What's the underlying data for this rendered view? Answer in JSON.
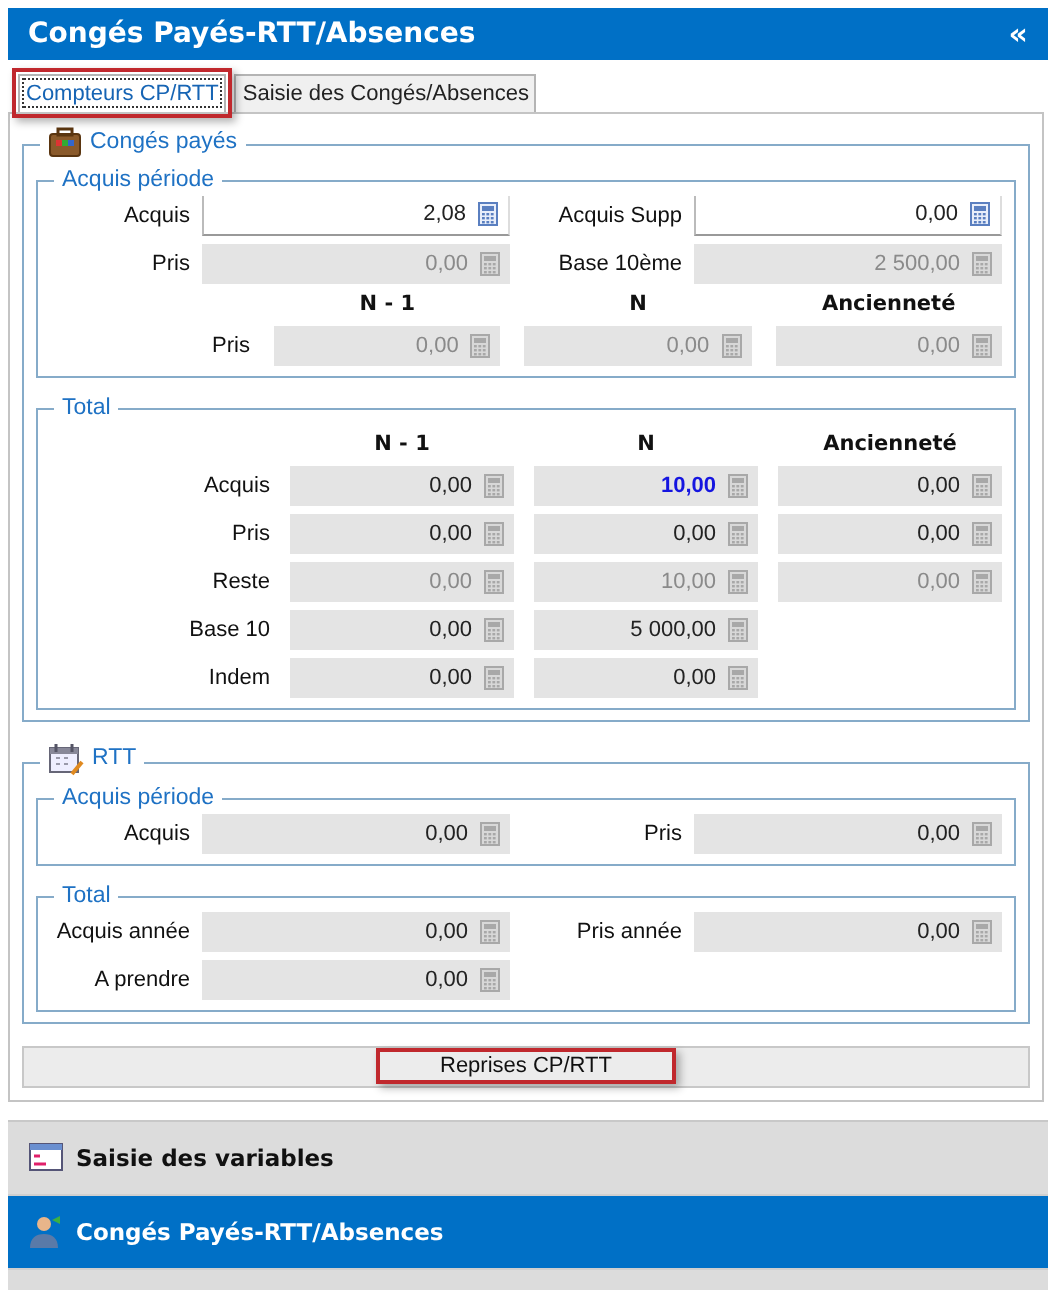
{
  "header": {
    "title": "Congés Payés-RTT/Absences",
    "collapse_icon": "«"
  },
  "tabs": [
    {
      "label": "Compteurs CP/RTT",
      "selected": true,
      "highlighted": true
    },
    {
      "label": "Saisie des Congés/Absences",
      "selected": false,
      "highlighted": false
    }
  ],
  "conges_payes": {
    "title": "Congés payés",
    "acquis_periode": {
      "title": "Acquis période",
      "fields": [
        {
          "label": "Acquis",
          "value": "2,08",
          "editable": true,
          "disabled": false,
          "highlighted": false
        },
        {
          "label": "Acquis Supp",
          "value": "0,00",
          "editable": true,
          "disabled": false,
          "highlighted": false
        },
        {
          "label": "Pris",
          "value": "0,00",
          "editable": false,
          "disabled": true,
          "highlighted": false
        },
        {
          "label": "Base 10ème",
          "value": "2 500,00",
          "editable": false,
          "disabled": true,
          "highlighted": false
        }
      ],
      "columns": [
        "N - 1",
        "N",
        "Ancienneté"
      ],
      "rows": [
        {
          "label": "Pris",
          "cells": [
            {
              "value": "0,00",
              "editable": false,
              "disabled": true,
              "highlighted": false
            },
            {
              "value": "0,00",
              "editable": false,
              "disabled": true,
              "highlighted": false
            },
            {
              "value": "0,00",
              "editable": false,
              "disabled": true,
              "highlighted": false
            }
          ]
        }
      ]
    },
    "total": {
      "title": "Total",
      "columns": [
        "N - 1",
        "N",
        "Ancienneté"
      ],
      "rows": [
        {
          "label": "Acquis",
          "cells": [
            {
              "value": "0,00",
              "editable": false,
              "disabled": false,
              "highlighted": false
            },
            {
              "value": "10,00",
              "editable": false,
              "disabled": false,
              "highlighted": true
            },
            {
              "value": "0,00",
              "editable": false,
              "disabled": false,
              "highlighted": false
            }
          ]
        },
        {
          "label": "Pris",
          "cells": [
            {
              "value": "0,00",
              "editable": false,
              "disabled": false,
              "highlighted": false
            },
            {
              "value": "0,00",
              "editable": false,
              "disabled": false,
              "highlighted": false
            },
            {
              "value": "0,00",
              "editable": false,
              "disabled": false,
              "highlighted": false
            }
          ]
        },
        {
          "label": "Reste",
          "cells": [
            {
              "value": "0,00",
              "editable": false,
              "disabled": true,
              "highlighted": false
            },
            {
              "value": "10,00",
              "editable": false,
              "disabled": true,
              "highlighted": false
            },
            {
              "value": "0,00",
              "editable": false,
              "disabled": true,
              "highlighted": false
            }
          ]
        },
        {
          "label": "Base 10",
          "cells": [
            {
              "value": "0,00",
              "editable": false,
              "disabled": false,
              "highlighted": false
            },
            {
              "value": "5 000,00",
              "editable": false,
              "disabled": false,
              "highlighted": false
            }
          ]
        },
        {
          "label": "Indem",
          "cells": [
            {
              "value": "0,00",
              "editable": false,
              "disabled": false,
              "highlighted": false
            },
            {
              "value": "0,00",
              "editable": false,
              "disabled": false,
              "highlighted": false
            }
          ]
        }
      ]
    }
  },
  "rtt": {
    "title": "RTT",
    "acquis_periode": {
      "title": "Acquis période",
      "fields": [
        {
          "label": "Acquis",
          "value": "0,00",
          "editable": false,
          "disabled": false,
          "highlighted": false
        },
        {
          "label": "Pris",
          "value": "0,00",
          "editable": false,
          "disabled": false,
          "highlighted": false
        }
      ]
    },
    "total": {
      "title": "Total",
      "fields": [
        {
          "label": "Acquis année",
          "value": "0,00",
          "editable": false,
          "disabled": false,
          "highlighted": false
        },
        {
          "label": "Pris année",
          "value": "0,00",
          "editable": false,
          "disabled": false,
          "highlighted": false
        },
        {
          "label": "A prendre",
          "value": "0,00",
          "editable": false,
          "disabled": false,
          "highlighted": false
        }
      ]
    }
  },
  "reprises_button": {
    "label": "Reprises CP/RTT",
    "highlighted": true
  },
  "nav": [
    {
      "label": "Saisie des variables",
      "selected": false
    },
    {
      "label": "Congés Payés-RTT/Absences",
      "selected": true
    }
  ]
}
